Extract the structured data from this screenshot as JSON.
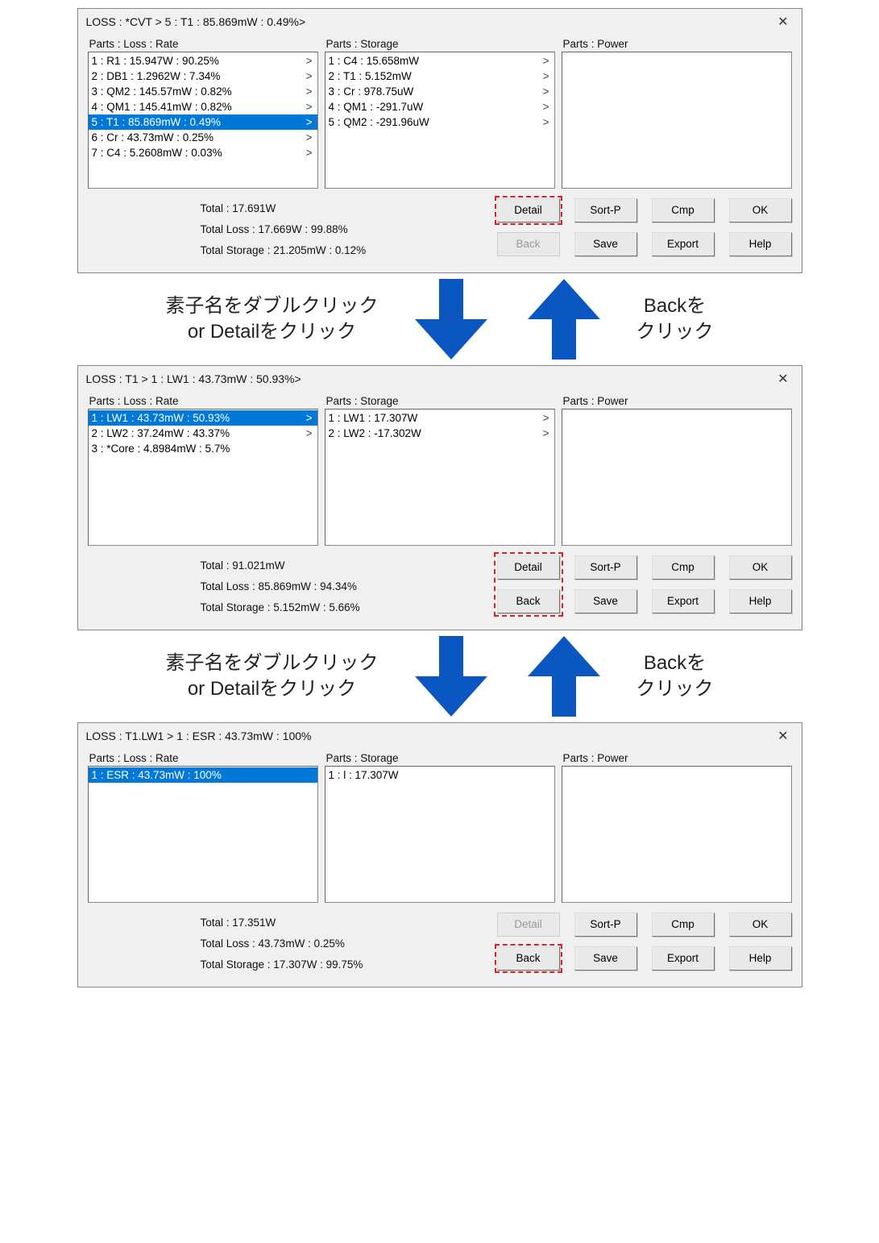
{
  "labels": {
    "parts_loss_rate": "Parts : Loss : Rate",
    "parts_storage": "Parts : Storage",
    "parts_power": "Parts : Power"
  },
  "buttons": {
    "detail": "Detail",
    "sortp": "Sort-P",
    "cmp": "Cmp",
    "ok": "OK",
    "back": "Back",
    "save": "Save",
    "export": "Export",
    "help": "Help"
  },
  "annotations": {
    "down_left": "素子名をダブルクリック\nor Detailをクリック",
    "up_right": "Backを\nクリック"
  },
  "dialog1": {
    "title": "LOSS : *CVT > 5 : T1 : 85.869mW : 0.49%>",
    "loss": [
      {
        "text": "1 : R1 : 15.947W : 90.25%",
        "chev": true,
        "sel": false
      },
      {
        "text": "2 : DB1 : 1.2962W : 7.34%",
        "chev": true,
        "sel": false
      },
      {
        "text": "3 : QM2 : 145.57mW : 0.82%",
        "chev": true,
        "sel": false
      },
      {
        "text": "4 : QM1 : 145.41mW : 0.82%",
        "chev": true,
        "sel": false
      },
      {
        "text": "5 : T1 : 85.869mW : 0.49%",
        "chev": true,
        "sel": true
      },
      {
        "text": "6 : Cr : 43.73mW : 0.25%",
        "chev": true,
        "sel": false
      },
      {
        "text": "7 : C4 : 5.2608mW : 0.03%",
        "chev": true,
        "sel": false
      }
    ],
    "storage": [
      {
        "text": "1 : C4 : 15.658mW",
        "chev": true
      },
      {
        "text": "2 : T1 : 5.152mW",
        "chev": true
      },
      {
        "text": "3 : Cr : 978.75uW",
        "chev": true
      },
      {
        "text": "4 : QM1 : -291.7uW",
        "chev": true
      },
      {
        "text": "5 : QM2 : -291.96uW",
        "chev": true
      }
    ],
    "totals": {
      "total": "Total : 17.691W",
      "total_loss": "Total Loss : 17.669W : 99.88%",
      "total_storage": "Total Storage : 21.205mW : 0.12%"
    },
    "detail_dashed": true,
    "back_disabled": true,
    "back_dashed": false,
    "detail_disabled": false,
    "detail_back_group_dashed": false
  },
  "dialog2": {
    "title": "LOSS : T1 > 1 : LW1 : 43.73mW : 50.93%>",
    "loss": [
      {
        "text": "1 : LW1 : 43.73mW : 50.93%",
        "chev": true,
        "sel": true
      },
      {
        "text": "2 : LW2 : 37.24mW : 43.37%",
        "chev": true,
        "sel": false
      },
      {
        "text": "3 : *Core : 4.8984mW : 5.7%",
        "chev": false,
        "sel": false
      }
    ],
    "storage": [
      {
        "text": "1 : LW1 : 17.307W",
        "chev": true
      },
      {
        "text": "2 : LW2 : -17.302W",
        "chev": true
      }
    ],
    "totals": {
      "total": "Total : 91.021mW",
      "total_loss": "Total Loss : 85.869mW : 94.34%",
      "total_storage": "Total Storage : 5.152mW : 5.66%"
    },
    "detail_dashed": false,
    "back_disabled": false,
    "back_dashed": false,
    "detail_disabled": false,
    "detail_back_group_dashed": true
  },
  "dialog3": {
    "title": "LOSS : T1.LW1 > 1 : ESR : 43.73mW : 100%",
    "loss": [
      {
        "text": "1 : ESR : 43.73mW : 100%",
        "chev": false,
        "sel": true
      }
    ],
    "storage": [
      {
        "text": "1 : l : 17.307W",
        "chev": false
      }
    ],
    "totals": {
      "total": "Total : 17.351W",
      "total_loss": "Total Loss : 43.73mW : 0.25%",
      "total_storage": "Total Storage : 17.307W : 99.75%"
    },
    "detail_dashed": false,
    "back_disabled": false,
    "back_dashed": true,
    "detail_disabled": true,
    "detail_back_group_dashed": false
  }
}
